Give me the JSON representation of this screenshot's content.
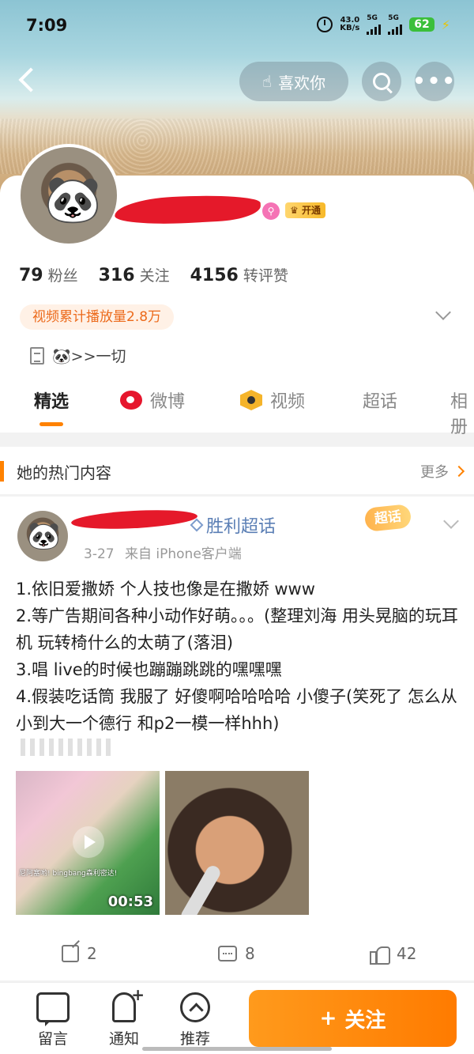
{
  "status_bar": {
    "time": "7:09",
    "net_speed_value": "43.0",
    "net_speed_unit": "KB/s",
    "sig1_label": "5G",
    "sig2_label": "5G",
    "battery": "62"
  },
  "header": {
    "like_label": "喜欢你",
    "more_glyph": "•••"
  },
  "profile": {
    "vip_label": "开通",
    "stats": [
      {
        "num": "79",
        "label": "粉丝"
      },
      {
        "num": "316",
        "label": "关注"
      },
      {
        "num": "4156",
        "label": "转评赞"
      }
    ],
    "video_badge": "视频累计播放量2.8万",
    "bio": "🐼>>一切",
    "tabs": [
      "精选",
      "微博",
      "视频",
      "超话",
      "相册"
    ]
  },
  "hot": {
    "title": "她的热门内容",
    "more": "更多"
  },
  "post": {
    "topic": "胜利超话",
    "badge": "超话",
    "date": "3-27",
    "source": "来自 iPhone客户端",
    "lines": [
      "1.依旧爱撒娇 个人技也像是在撒娇 www",
      "2.等广告期间各种小动作好萌。。。(整理刘海 用头晃脑的玩耳机 玩转椅什么的太萌了(落泪)",
      "3.唱 live的时候也蹦蹦跳跳的嘿嘿嘿",
      "4.假装吃话筒 我服了 好傻啊哈哈哈哈 小傻子(笑死了 怎么从小到大一个德行 和p2一模一样hhh)"
    ],
    "video_duration": "00:53",
    "video_subtitle": "尼阿塞哟! bingbang森利密达!",
    "shares": "2",
    "comments": "8",
    "likes": "42"
  },
  "bottom_nav": {
    "items": [
      "留言",
      "通知",
      "推荐"
    ],
    "follow": "关注",
    "follow_plus": "+"
  },
  "colors": {
    "accent": "#ff8200",
    "redaction": "#e5192a",
    "link": "#5b7fb5"
  }
}
